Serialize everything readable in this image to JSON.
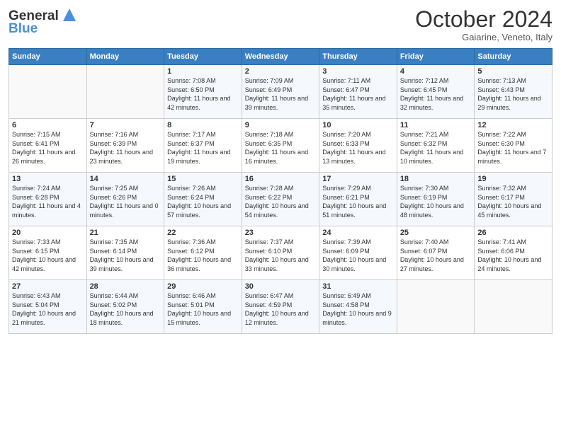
{
  "header": {
    "logo_line1": "General",
    "logo_line2": "Blue",
    "month": "October 2024",
    "location": "Gaiarine, Veneto, Italy"
  },
  "weekdays": [
    "Sunday",
    "Monday",
    "Tuesday",
    "Wednesday",
    "Thursday",
    "Friday",
    "Saturday"
  ],
  "weeks": [
    [
      {
        "day": "",
        "sunrise": "",
        "sunset": "",
        "daylight": ""
      },
      {
        "day": "",
        "sunrise": "",
        "sunset": "",
        "daylight": ""
      },
      {
        "day": "1",
        "sunrise": "Sunrise: 7:08 AM",
        "sunset": "Sunset: 6:50 PM",
        "daylight": "Daylight: 11 hours and 42 minutes."
      },
      {
        "day": "2",
        "sunrise": "Sunrise: 7:09 AM",
        "sunset": "Sunset: 6:49 PM",
        "daylight": "Daylight: 11 hours and 39 minutes."
      },
      {
        "day": "3",
        "sunrise": "Sunrise: 7:11 AM",
        "sunset": "Sunset: 6:47 PM",
        "daylight": "Daylight: 11 hours and 35 minutes."
      },
      {
        "day": "4",
        "sunrise": "Sunrise: 7:12 AM",
        "sunset": "Sunset: 6:45 PM",
        "daylight": "Daylight: 11 hours and 32 minutes."
      },
      {
        "day": "5",
        "sunrise": "Sunrise: 7:13 AM",
        "sunset": "Sunset: 6:43 PM",
        "daylight": "Daylight: 11 hours and 29 minutes."
      }
    ],
    [
      {
        "day": "6",
        "sunrise": "Sunrise: 7:15 AM",
        "sunset": "Sunset: 6:41 PM",
        "daylight": "Daylight: 11 hours and 26 minutes."
      },
      {
        "day": "7",
        "sunrise": "Sunrise: 7:16 AM",
        "sunset": "Sunset: 6:39 PM",
        "daylight": "Daylight: 11 hours and 23 minutes."
      },
      {
        "day": "8",
        "sunrise": "Sunrise: 7:17 AM",
        "sunset": "Sunset: 6:37 PM",
        "daylight": "Daylight: 11 hours and 19 minutes."
      },
      {
        "day": "9",
        "sunrise": "Sunrise: 7:18 AM",
        "sunset": "Sunset: 6:35 PM",
        "daylight": "Daylight: 11 hours and 16 minutes."
      },
      {
        "day": "10",
        "sunrise": "Sunrise: 7:20 AM",
        "sunset": "Sunset: 6:33 PM",
        "daylight": "Daylight: 11 hours and 13 minutes."
      },
      {
        "day": "11",
        "sunrise": "Sunrise: 7:21 AM",
        "sunset": "Sunset: 6:32 PM",
        "daylight": "Daylight: 11 hours and 10 minutes."
      },
      {
        "day": "12",
        "sunrise": "Sunrise: 7:22 AM",
        "sunset": "Sunset: 6:30 PM",
        "daylight": "Daylight: 11 hours and 7 minutes."
      }
    ],
    [
      {
        "day": "13",
        "sunrise": "Sunrise: 7:24 AM",
        "sunset": "Sunset: 6:28 PM",
        "daylight": "Daylight: 11 hours and 4 minutes."
      },
      {
        "day": "14",
        "sunrise": "Sunrise: 7:25 AM",
        "sunset": "Sunset: 6:26 PM",
        "daylight": "Daylight: 11 hours and 0 minutes."
      },
      {
        "day": "15",
        "sunrise": "Sunrise: 7:26 AM",
        "sunset": "Sunset: 6:24 PM",
        "daylight": "Daylight: 10 hours and 57 minutes."
      },
      {
        "day": "16",
        "sunrise": "Sunrise: 7:28 AM",
        "sunset": "Sunset: 6:22 PM",
        "daylight": "Daylight: 10 hours and 54 minutes."
      },
      {
        "day": "17",
        "sunrise": "Sunrise: 7:29 AM",
        "sunset": "Sunset: 6:21 PM",
        "daylight": "Daylight: 10 hours and 51 minutes."
      },
      {
        "day": "18",
        "sunrise": "Sunrise: 7:30 AM",
        "sunset": "Sunset: 6:19 PM",
        "daylight": "Daylight: 10 hours and 48 minutes."
      },
      {
        "day": "19",
        "sunrise": "Sunrise: 7:32 AM",
        "sunset": "Sunset: 6:17 PM",
        "daylight": "Daylight: 10 hours and 45 minutes."
      }
    ],
    [
      {
        "day": "20",
        "sunrise": "Sunrise: 7:33 AM",
        "sunset": "Sunset: 6:15 PM",
        "daylight": "Daylight: 10 hours and 42 minutes."
      },
      {
        "day": "21",
        "sunrise": "Sunrise: 7:35 AM",
        "sunset": "Sunset: 6:14 PM",
        "daylight": "Daylight: 10 hours and 39 minutes."
      },
      {
        "day": "22",
        "sunrise": "Sunrise: 7:36 AM",
        "sunset": "Sunset: 6:12 PM",
        "daylight": "Daylight: 10 hours and 36 minutes."
      },
      {
        "day": "23",
        "sunrise": "Sunrise: 7:37 AM",
        "sunset": "Sunset: 6:10 PM",
        "daylight": "Daylight: 10 hours and 33 minutes."
      },
      {
        "day": "24",
        "sunrise": "Sunrise: 7:39 AM",
        "sunset": "Sunset: 6:09 PM",
        "daylight": "Daylight: 10 hours and 30 minutes."
      },
      {
        "day": "25",
        "sunrise": "Sunrise: 7:40 AM",
        "sunset": "Sunset: 6:07 PM",
        "daylight": "Daylight: 10 hours and 27 minutes."
      },
      {
        "day": "26",
        "sunrise": "Sunrise: 7:41 AM",
        "sunset": "Sunset: 6:06 PM",
        "daylight": "Daylight: 10 hours and 24 minutes."
      }
    ],
    [
      {
        "day": "27",
        "sunrise": "Sunrise: 6:43 AM",
        "sunset": "Sunset: 5:04 PM",
        "daylight": "Daylight: 10 hours and 21 minutes."
      },
      {
        "day": "28",
        "sunrise": "Sunrise: 6:44 AM",
        "sunset": "Sunset: 5:02 PM",
        "daylight": "Daylight: 10 hours and 18 minutes."
      },
      {
        "day": "29",
        "sunrise": "Sunrise: 6:46 AM",
        "sunset": "Sunset: 5:01 PM",
        "daylight": "Daylight: 10 hours and 15 minutes."
      },
      {
        "day": "30",
        "sunrise": "Sunrise: 6:47 AM",
        "sunset": "Sunset: 4:59 PM",
        "daylight": "Daylight: 10 hours and 12 minutes."
      },
      {
        "day": "31",
        "sunrise": "Sunrise: 6:49 AM",
        "sunset": "Sunset: 4:58 PM",
        "daylight": "Daylight: 10 hours and 9 minutes."
      },
      {
        "day": "",
        "sunrise": "",
        "sunset": "",
        "daylight": ""
      },
      {
        "day": "",
        "sunrise": "",
        "sunset": "",
        "daylight": ""
      }
    ]
  ]
}
